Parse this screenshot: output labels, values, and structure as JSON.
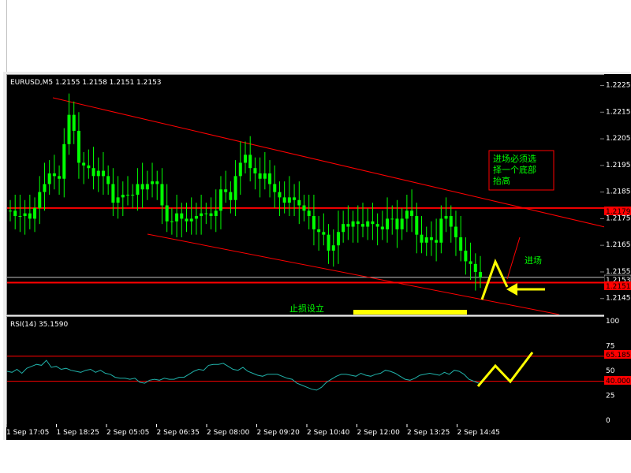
{
  "chart_title": "EURUSD,M5  1.2155 1.2158 1.2151 1.2153",
  "rsi_title": "RSI(14)  35.1590",
  "price_labels": [
    "1.2225",
    "1.2215",
    "1.2205",
    "1.2195",
    "1.2185",
    "1.2175",
    "1.2165",
    "1.2155",
    "1.2145"
  ],
  "price_marker_1": "1.2179",
  "price_marker_2": "1.2153",
  "price_marker_3": "1.2151",
  "rsi_labels": [
    "100",
    "75",
    "50",
    "25",
    "0"
  ],
  "rsi_marker_1": "65.1850",
  "rsi_marker_2": "40.0000",
  "time_labels": [
    "1 Sep 17:05",
    "1 Sep 18:25",
    "2 Sep 05:05",
    "2 Sep 06:35",
    "2 Sep 08:00",
    "2 Sep 09:20",
    "2 Sep 10:40",
    "2 Sep 12:00",
    "2 Sep 13:25",
    "2 Sep 14:45"
  ],
  "annotations": {
    "box_text": [
      "进场必须选",
      "择一个底部",
      "抬高"
    ],
    "entry_label": "进场",
    "stop_label": "止损设立"
  },
  "colors": {
    "candle": "#00ff00",
    "rsi_line": "#20b2aa",
    "level_line": "#ff0000",
    "channel_line": "#ff0000",
    "marker": "#ffff00",
    "annotation_text": "#00ff00"
  },
  "chart_data": [
    {
      "type": "candlestick",
      "title": "EURUSD,M5",
      "ohlc_last": {
        "open": 1.2155,
        "high": 1.2158,
        "low": 1.2151,
        "close": 1.2153
      },
      "ylim": [
        1.2139,
        1.2229
      ],
      "y_ticks": [
        1.2225,
        1.2215,
        1.2205,
        1.2195,
        1.2185,
        1.2175,
        1.2165,
        1.2155,
        1.2145
      ],
      "horizontal_levels": [
        1.2179,
        1.2153,
        1.2151
      ],
      "channel": {
        "upper": {
          "x": [
            "1 Sep 17:45",
            "2 Sep 14:45+"
          ],
          "y": [
            1.2222,
            1.2172
          ]
        },
        "lower": {
          "x": [
            "2 Sep 05:05",
            "2 Sep 14:45+"
          ],
          "y": [
            1.217,
            1.2144
          ]
        }
      },
      "close_series": [
        1.2178,
        1.2176,
        1.2176,
        1.2177,
        1.2175,
        1.2179,
        1.2185,
        1.2188,
        1.2192,
        1.2191,
        1.219,
        1.2203,
        1.2214,
        1.2208,
        1.2196,
        1.2195,
        1.2194,
        1.2191,
        1.2193,
        1.2191,
        1.2188,
        1.2181,
        1.2183,
        1.2184,
        1.2184,
        1.2184,
        1.2188,
        1.2186,
        1.2188,
        1.2189,
        1.2188,
        1.218,
        1.2174,
        1.2174,
        1.2177,
        1.2175,
        1.2174,
        1.2175,
        1.2176,
        1.2177,
        1.2177,
        1.2176,
        1.2178,
        1.2186,
        1.2185,
        1.2182,
        1.2191,
        1.2196,
        1.2199,
        1.2194,
        1.2192,
        1.219,
        1.2192,
        1.2188,
        1.2185,
        1.2183,
        1.2181,
        1.2183,
        1.2182,
        1.218,
        1.2178,
        1.2176,
        1.2171,
        1.217,
        1.2169,
        1.2163,
        1.2165,
        1.217,
        1.2173,
        1.2172,
        1.2174,
        1.2173,
        1.2172,
        1.2174,
        1.2173,
        1.2172,
        1.2171,
        1.2175,
        1.2175,
        1.2171,
        1.2175,
        1.2178,
        1.2176,
        1.2169,
        1.2166,
        1.2168,
        1.2167,
        1.2166,
        1.2175,
        1.2176,
        1.2172,
        1.2168,
        1.2163,
        1.2159,
        1.2158,
        1.2155,
        1.2153
      ]
    },
    {
      "type": "line",
      "title": "RSI(14)",
      "last_value": 35.159,
      "ylim": [
        0,
        100
      ],
      "y_ticks": [
        100,
        75,
        50,
        25,
        0
      ],
      "levels": [
        65.185,
        40.0
      ],
      "series": [
        {
          "values": [
            50,
            49,
            52,
            48,
            53,
            55,
            57,
            56,
            61,
            54,
            55,
            52,
            53,
            51,
            50,
            49,
            51,
            52,
            49,
            51,
            48,
            47,
            44,
            43,
            43,
            42,
            43,
            39,
            38,
            41,
            42,
            41,
            43,
            42,
            42,
            44,
            44,
            47,
            50,
            52,
            51,
            56,
            57,
            57,
            58,
            55,
            52,
            51,
            54,
            50,
            48,
            46,
            45,
            47,
            47,
            47,
            45,
            43,
            42,
            38,
            36,
            34,
            32,
            31,
            34,
            39,
            42,
            45,
            47,
            47,
            46,
            45,
            48,
            46,
            45,
            47,
            48,
            51,
            50,
            48,
            45,
            42,
            41,
            43,
            46,
            47,
            48,
            47,
            46,
            49,
            47,
            51,
            50,
            47,
            42,
            40,
            38
          ]
        }
      ]
    }
  ]
}
